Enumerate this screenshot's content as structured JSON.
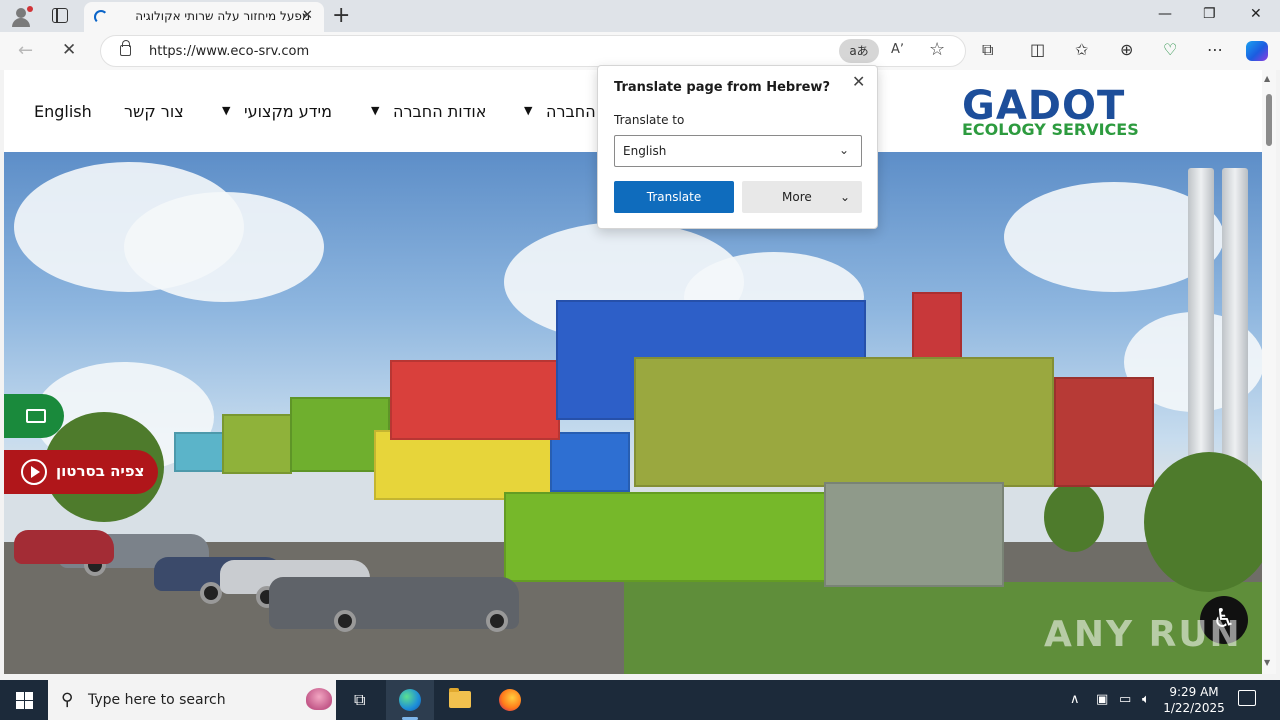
{
  "browser": {
    "tab_title": "מפעל מיחזור עלה שרותי אקולוגיה",
    "tab_close": "✕",
    "new_tab": "+",
    "window_controls": {
      "minimize": "—",
      "restore": "❐",
      "close": "✕"
    },
    "url": "https://www.eco-srv.com",
    "translate_icon_label": "aあ",
    "read_aloud_label": "Aʼ",
    "star": "☆",
    "toolbar_icons": [
      "extensions-icon",
      "split-screen-icon",
      "favorites-icon",
      "collections-icon",
      "performance-icon",
      "more-icon",
      "copilot-icon"
    ]
  },
  "translate_popup": {
    "title": "Translate page from Hebrew?",
    "translate_to_label": "Translate to",
    "selected_language": "English",
    "translate_button": "Translate",
    "more_button": "More"
  },
  "site": {
    "logo_main": "GADOT",
    "logo_sub": "ECOLOGY SERVICES",
    "nav": {
      "english": "English",
      "contact": "צור קשר",
      "professional_info": "מידע מקצועי",
      "about": "אודות החברה",
      "company": "החברה"
    },
    "video_button": "צפיה בסרטון",
    "watermark": "ANY RUN"
  },
  "taskbar": {
    "search_placeholder": "Type here to search",
    "time": "9:29 AM",
    "date": "1/22/2025"
  },
  "colors": {
    "brand_blue": "#1d4e9a",
    "brand_green": "#2d9b3f",
    "video_red": "#b0161a",
    "translate_blue": "#0f6cbd"
  }
}
